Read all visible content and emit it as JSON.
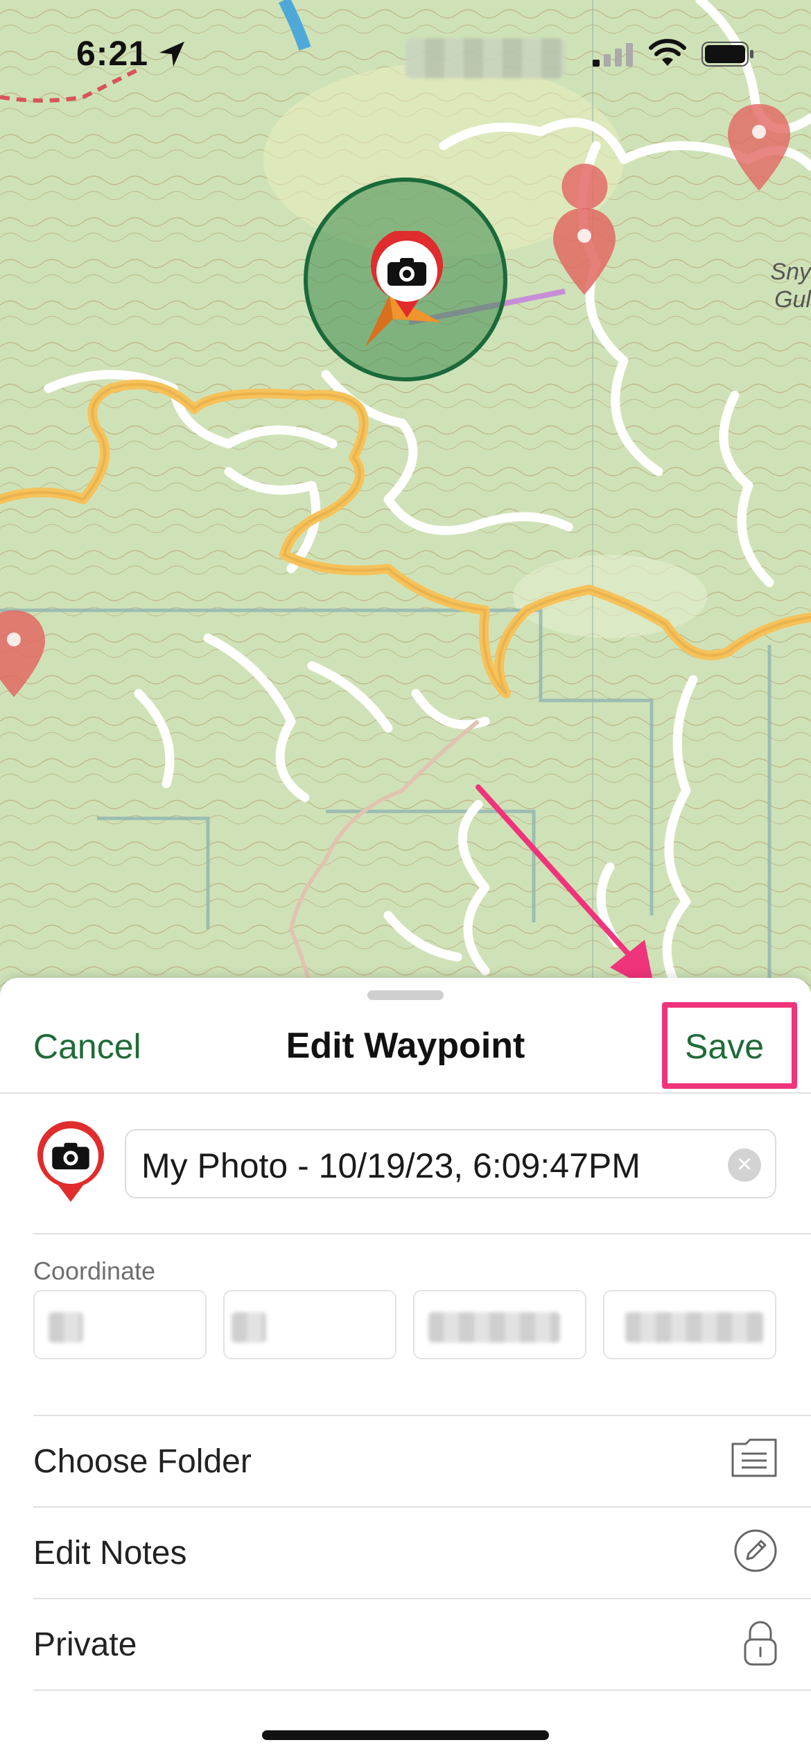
{
  "status_bar": {
    "time": "6:21"
  },
  "map": {
    "marker_icon": "camera-icon",
    "pin_color": "#e05b5b",
    "road_color": "#f6c25a",
    "map_label_lines": [
      "Sny",
      "Gul"
    ]
  },
  "sheet": {
    "cancel_label": "Cancel",
    "title": "Edit Waypoint",
    "save_label": "Save",
    "highlight_color": "#f0347b",
    "accent_color": "#1f6b36",
    "waypoint_icon": "camera-icon",
    "name_value": "My Photo - 10/19/23, 6:09:47PM",
    "coordinate_label": "Coordinate",
    "rows": [
      {
        "label": "Choose Folder",
        "icon": "folder-icon"
      },
      {
        "label": "Edit Notes",
        "icon": "pencil-icon"
      },
      {
        "label": "Private",
        "icon": "lock-icon"
      }
    ]
  }
}
